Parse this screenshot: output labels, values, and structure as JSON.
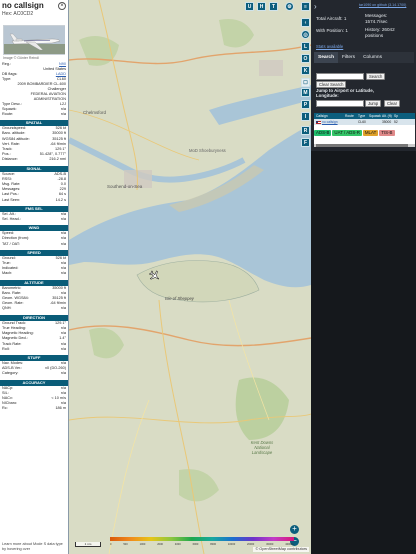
{
  "info": {
    "callsign": "no callsign",
    "hex_label": "Hex:",
    "hex": "AC0CD2",
    "photo_credit": "Image © Günter Reindl",
    "reg_label": "Reg.:",
    "reg": "N90",
    "country": "United States",
    "dbflags_label": "DB flags:",
    "dbflags": "LADD",
    "type_label": "Type:",
    "type": "CL60",
    "model": "2009 BOMBARDIER CL-600 Challenger",
    "operator": "FEDERAL AVIATION ADMINISTRATION",
    "typedesc_label": "Type Desc.:",
    "typedesc": "L2J",
    "squawk_label": "Squawk:",
    "squawk": "n/a",
    "route_label": "Route:",
    "route": "n/a",
    "footer_note": "Learn more about Mode S data type by hovering over"
  },
  "sections": {
    "spatial": "SPATIAL",
    "signal": "SIGNAL",
    "fms": "FMS SEL",
    "wind": "WIND",
    "speed": "SPEED",
    "altitude": "ALTITUDE",
    "direction": "DIRECTION",
    "stuff": "STUFF",
    "accuracy": "ACCURACY"
  },
  "spatial": [
    {
      "label": "Groundspeed:",
      "value": "526 kt"
    },
    {
      "label": "Baro. altitude:",
      "value": "35000 ft"
    },
    {
      "label": "WGS84 altitude:",
      "value": "35125 ft"
    },
    {
      "label": "Vert. Rate:",
      "value": "-64 ft/min"
    },
    {
      "label": "Track:",
      "value": "129.1°"
    },
    {
      "label": "Pos.:",
      "value": "51.428°, 0.777°"
    },
    {
      "label": "Distance:",
      "value": "216.2 nmi"
    }
  ],
  "signal": [
    {
      "label": "Source:",
      "value": "ADS-B"
    },
    {
      "label": "RSSI:",
      "value": "-28.8"
    },
    {
      "label": "Msg. Rate:",
      "value": "0.0"
    },
    {
      "label": "Messages:",
      "value": "229"
    },
    {
      "label": "Last Pos.:",
      "value": "64 s"
    },
    {
      "label": "Last Seen:",
      "value": "14.2 s"
    }
  ],
  "fms": [
    {
      "label": "Sel. Alt.:",
      "value": "n/a"
    },
    {
      "label": "Sel. Head.:",
      "value": "n/a"
    }
  ],
  "wind": [
    {
      "label": "Speed:",
      "value": "n/a"
    },
    {
      "label": "Direction (from):",
      "value": "n/a"
    },
    {
      "label": "TAT / OAT:",
      "value": "n/a"
    }
  ],
  "speed": [
    {
      "label": "Ground:",
      "value": "526 kt"
    },
    {
      "label": "True:",
      "value": "n/a"
    },
    {
      "label": "Indicated:",
      "value": "n/a"
    },
    {
      "label": "Mach:",
      "value": "n/a"
    }
  ],
  "altitude": [
    {
      "label": "Barometric:",
      "value": "35000 ft"
    },
    {
      "label": "Baro. Rate:",
      "value": "n/a"
    },
    {
      "label": "Geom. WGS84:",
      "value": "35125 ft"
    },
    {
      "label": "Geom. Rate:",
      "value": "-64 ft/min"
    },
    {
      "label": "QNH:",
      "value": "n/a"
    }
  ],
  "direction": [
    {
      "label": "Ground Track:",
      "value": "129.1°"
    },
    {
      "label": "True Heading:",
      "value": "n/a"
    },
    {
      "label": "Magnetic Heading:",
      "value": "n/a"
    },
    {
      "label": "Magnetic Decl.:",
      "value": "1.4°"
    },
    {
      "label": "Track Rate:",
      "value": "n/a"
    },
    {
      "label": "Roll:",
      "value": "n/a"
    }
  ],
  "stuff": [
    {
      "label": "Nav. Modes:",
      "value": "n/a"
    },
    {
      "label": "ADS-B Ver.:",
      "value": "v0 (DO-260)"
    },
    {
      "label": "Category:",
      "value": "n/a"
    }
  ],
  "accuracy": [
    {
      "label": "NACp:",
      "value": "n/a"
    },
    {
      "label": "SIL:",
      "value": "n/a"
    },
    {
      "label": "NACv:",
      "value": "< 10 m/s"
    },
    {
      "label": "NICbaro:",
      "value": "n/a"
    },
    {
      "label": "Rc:",
      "value": "186 m"
    }
  ],
  "map": {
    "top_buttons": [
      "U",
      "H",
      "T"
    ],
    "labels": {
      "chelmsford": "Chelmsford",
      "southend": "Southend-on-Sea",
      "sheppey": "Isle of Sheppey",
      "kent_downs": "Kent Downs National Landscape",
      "mod": "MoD Shoeburyness"
    },
    "scale_text": "1 nm",
    "attribution": "© OpenStreetMap contributors",
    "zoom_in": "+",
    "zoom_out": "−",
    "altitude_ticks": [
      "0",
      "500",
      "1000",
      "2000",
      "4000",
      "6000",
      "8000",
      "10000",
      "20000",
      "30000",
      "40000+"
    ]
  },
  "controls": {
    "side_buttons": [
      "L",
      "O",
      "K",
      "M",
      "P",
      "I",
      "R",
      "F"
    ],
    "gear_icon": "gear-icon",
    "layers_icon": "layers-icon"
  },
  "panel": {
    "github": "tar1090 on github (3.14.1700)",
    "total_aircraft_label": "Total Aircraft:",
    "total_aircraft": "1",
    "with_position_label": "With Position:",
    "with_position": "1",
    "messages_label": "Messages:",
    "messages": "1574.7/sec",
    "history_label": "History:",
    "history": "26042 positions",
    "stats_link": "Stats available",
    "tabs": [
      "Search",
      "Filters",
      "Columns"
    ],
    "search_button": "Search",
    "clear_search": "Clear Search",
    "jump_label": "Jump to Airport or Latitude, Longitude:",
    "jump_button": "Jump",
    "clear_button": "Clear",
    "columns": [
      "Callsign",
      "Route",
      "Type",
      "Squawk",
      "Alt. (ft)",
      "Sp"
    ],
    "row": {
      "flag": "US",
      "callsign": "no callsign",
      "route": "",
      "type": "CL60",
      "squawk": "",
      "alt": "35000",
      "spd": "52"
    },
    "sources": [
      {
        "label": "ADS-B",
        "color": "#1ebd6c"
      },
      {
        "label": "UAT / ADS-R",
        "color": "#33c467"
      },
      {
        "label": "MLAT",
        "color": "#e0a22a"
      },
      {
        "label": "TIS-B",
        "color": "#e08a8a"
      }
    ],
    "mode_s": "Mode-S"
  }
}
